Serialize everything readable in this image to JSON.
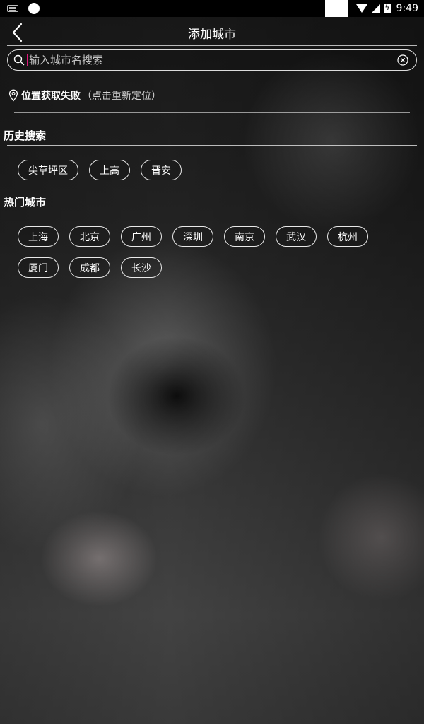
{
  "status_bar": {
    "time": "9:49",
    "icons": [
      "keyboard-icon",
      "circle-icon",
      "wifi-icon",
      "signal-icon",
      "battery-charging-icon"
    ]
  },
  "header": {
    "title": "添加城市",
    "back_icon": "chevron-left-icon"
  },
  "search": {
    "placeholder": "输入城市名搜索",
    "value": "",
    "icon": "search-icon",
    "clear_icon": "clear-circle-icon"
  },
  "location": {
    "icon": "location-pin-icon",
    "status": "位置获取失败",
    "hint": "（点击重新定位）"
  },
  "history": {
    "title": "历史搜索",
    "items": [
      "尖草坪区",
      "上高",
      "晋安"
    ]
  },
  "hot": {
    "title": "热门城市",
    "items": [
      "上海",
      "北京",
      "广州",
      "深圳",
      "南京",
      "武汉",
      "杭州",
      "厦门",
      "成都",
      "长沙"
    ]
  },
  "colors": {
    "cursor": "#e0197d",
    "text": "#ffffff"
  }
}
